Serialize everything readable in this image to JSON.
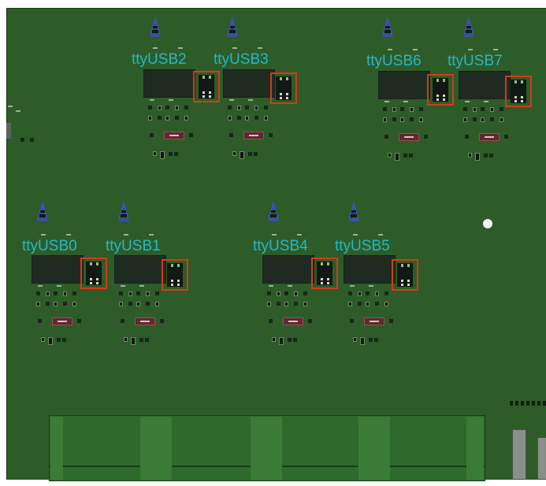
{
  "ports": [
    {
      "label": "ttyUSB2"
    },
    {
      "label": "ttyUSB3"
    },
    {
      "label": "ttyUSB6"
    },
    {
      "label": "ttyUSB7"
    },
    {
      "label": "ttyUSB0"
    },
    {
      "label": "ttyUSB1"
    },
    {
      "label": "ttyUSB4"
    },
    {
      "label": "ttyUSB5"
    }
  ],
  "colors": {
    "board": "#2d5c28",
    "label": "#26b7c7",
    "selection": "#d63a1a",
    "chip": "#1f2b20"
  },
  "icons": {
    "antenna": "antenna-icon"
  }
}
